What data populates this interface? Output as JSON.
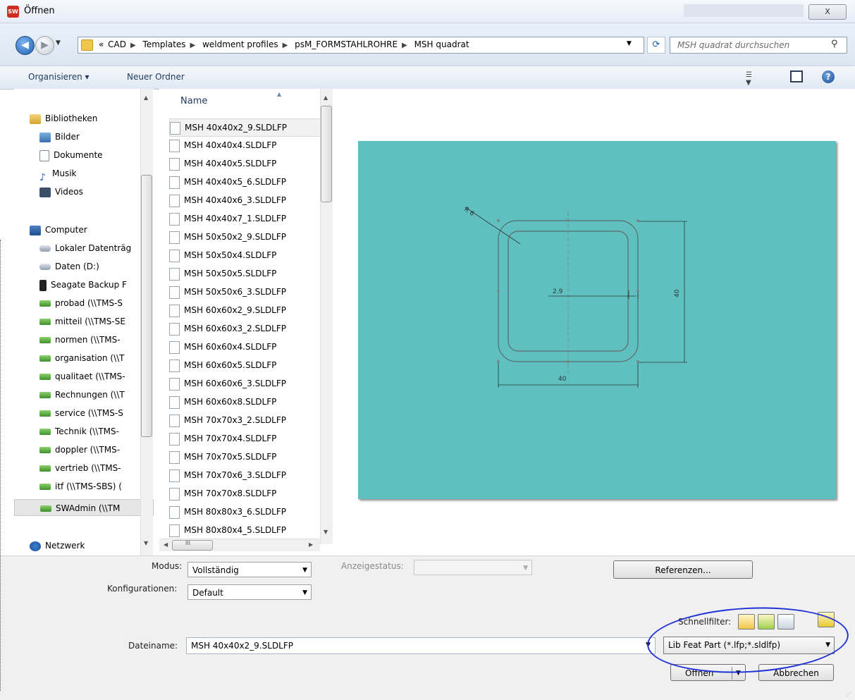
{
  "window": {
    "app_icon": "SW",
    "title": "Öffnen",
    "close_symbol": "X"
  },
  "address": {
    "prefix": "«",
    "crumbs": [
      "CAD",
      "Templates",
      "weldment profiles",
      "psM_FORMSTAHLROHRE",
      "MSH quadrat"
    ],
    "search_placeholder": "MSH quadrat durchsuchen"
  },
  "toolbar": {
    "organize_label": "Organisieren ▾",
    "new_folder_label": "Neuer Ordner",
    "help_symbol": "?"
  },
  "nav": {
    "items": [
      {
        "label": "Bibliotheken",
        "icon": "library-icon"
      },
      {
        "label": "Bilder",
        "icon": "pictures-icon"
      },
      {
        "label": "Dokumente",
        "icon": "documents-icon"
      },
      {
        "label": "Musik",
        "icon": "music-icon"
      },
      {
        "label": "Videos",
        "icon": "videos-icon"
      },
      {
        "label": "Computer",
        "icon": "computer-icon"
      },
      {
        "label": "Lokaler Datenträg",
        "icon": "drive-icon"
      },
      {
        "label": "Daten (D:)",
        "icon": "drive-icon"
      },
      {
        "label": "Seagate Backup F",
        "icon": "external-drive-icon"
      },
      {
        "label": "probad (\\\\TMS-S",
        "icon": "network-drive-icon"
      },
      {
        "label": "mitteil (\\\\TMS-SE",
        "icon": "network-drive-icon"
      },
      {
        "label": "normen (\\\\TMS-",
        "icon": "network-drive-icon"
      },
      {
        "label": "organisation (\\\\T",
        "icon": "network-drive-icon"
      },
      {
        "label": "qualitaet (\\\\TMS-",
        "icon": "network-drive-icon"
      },
      {
        "label": "Rechnungen (\\\\T",
        "icon": "network-drive-icon"
      },
      {
        "label": "service (\\\\TMS-S",
        "icon": "network-drive-icon"
      },
      {
        "label": "Technik (\\\\TMS-",
        "icon": "network-drive-icon"
      },
      {
        "label": "doppler (\\\\TMS-",
        "icon": "network-drive-icon"
      },
      {
        "label": "vertrieb (\\\\TMS-",
        "icon": "network-drive-icon"
      },
      {
        "label": "itf (\\\\TMS-SBS) (",
        "icon": "network-drive-icon"
      },
      {
        "label": "SWAdmin (\\\\TM",
        "icon": "network-drive-icon"
      },
      {
        "label": "Netzwerk",
        "icon": "network-icon"
      }
    ]
  },
  "files": {
    "column_header": "Name",
    "items": [
      "MSH 40x40x2_9.SLDLFP",
      "MSH 40x40x4.SLDLFP",
      "MSH 40x40x5.SLDLFP",
      "MSH 40x40x5_6.SLDLFP",
      "MSH 40x40x6_3.SLDLFP",
      "MSH 40x40x7_1.SLDLFP",
      "MSH 50x50x2_9.SLDLFP",
      "MSH 50x50x4.SLDLFP",
      "MSH 50x50x5.SLDLFP",
      "MSH 50x50x6_3.SLDLFP",
      "MSH 60x60x2_9.SLDLFP",
      "MSH 60x60x3_2.SLDLFP",
      "MSH 60x60x4.SLDLFP",
      "MSH 60x60x5.SLDLFP",
      "MSH 60x60x6_3.SLDLFP",
      "MSH 60x60x8.SLDLFP",
      "MSH 70x70x3_2.SLDLFP",
      "MSH 70x70x4.SLDLFP",
      "MSH 70x70x5.SLDLFP",
      "MSH 70x70x6_3.SLDLFP",
      "MSH 70x70x8.SLDLFP",
      "MSH 80x80x3_6.SLDLFP",
      "MSH 80x80x4_5.SLDLFP"
    ],
    "selected_index": 0,
    "hscroll_symbol": "III"
  },
  "preview": {
    "background": "#60c0c0",
    "dim_radius": "R 6",
    "dim_thickness": "2.9",
    "dim_height": "40",
    "dim_width": "40"
  },
  "options": {
    "mode_label": "Modus:",
    "mode_value": "Vollständig",
    "display_state_label": "Anzeigestatus:",
    "display_state_value": "",
    "references_button": "Referenzen...",
    "configurations_label": "Konfigurationen:",
    "configurations_value": "Default",
    "quickfilter_label": "Schnellfilter:",
    "filename_label": "Dateiname:",
    "filename_value": "MSH 40x40x2_9.SLDLFP",
    "filetype_value": "Lib Feat Part (*.lfp;*.sldlfp)",
    "open_button": "Öffnen",
    "cancel_button": "Abbrechen"
  },
  "colors": {
    "annotation_circle": "#1f32d8",
    "preview_bg": "#60c0c0"
  }
}
